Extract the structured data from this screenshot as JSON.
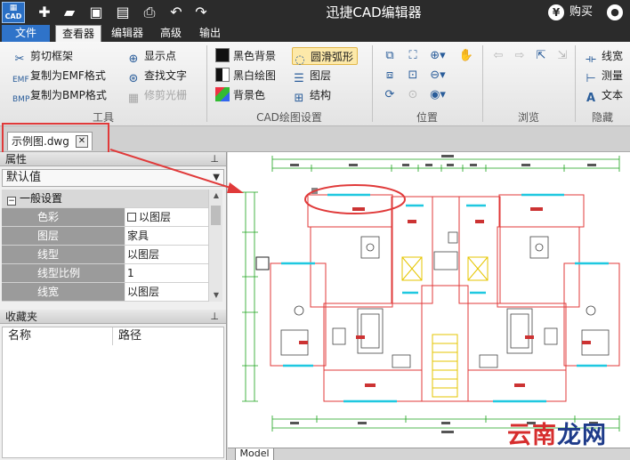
{
  "app": {
    "logo_text": "CAD",
    "title": "迅捷CAD编辑器",
    "buy_label": "购买",
    "currency_symbol": "¥"
  },
  "quick_access": [
    "new-icon",
    "open-icon",
    "save-icon",
    "save-as-icon",
    "print-icon",
    "undo-icon",
    "redo-icon"
  ],
  "menu": {
    "file": "文件",
    "viewer": "查看器",
    "editor": "编辑器",
    "advanced": "高级",
    "export": "输出"
  },
  "ribbon": {
    "tools": {
      "label": "工具",
      "clip_frame": "剪切框架",
      "copy_emf": "复制为EMF格式",
      "copy_bmp": "复制为BMP格式",
      "show_points": "显示点",
      "find_text": "查找文字",
      "trim_raster": "修剪光栅"
    },
    "cad_settings": {
      "label": "CAD绘图设置",
      "black_bg": "黑色背景",
      "bw_drawing": "黑白绘图",
      "bg_color": "背景色",
      "smooth_arc": "圆滑弧形",
      "layers": "图层",
      "structure": "结构"
    },
    "position": {
      "label": "位置"
    },
    "browse": {
      "label": "浏览"
    },
    "hide": {
      "label": "隐藏",
      "line_width": "线宽",
      "measure": "测量",
      "text": "文本"
    }
  },
  "doc_tab": {
    "name": "示例图.dwg"
  },
  "properties": {
    "title": "属性",
    "selector": "默认值",
    "category": "一般设置",
    "rows": [
      {
        "key": "色彩",
        "value": "以图层"
      },
      {
        "key": "图层",
        "value": "家具"
      },
      {
        "key": "线型",
        "value": "以图层"
      },
      {
        "key": "线型比例",
        "value": "1"
      },
      {
        "key": "线宽",
        "value": "以图层"
      }
    ]
  },
  "favorites": {
    "title": "收藏夹",
    "col_name": "名称",
    "col_path": "路径"
  },
  "model_tab": "Model",
  "watermark": {
    "red": "云南",
    "blue": "龙网"
  },
  "colors": {
    "titlebar": "#2b2b2b",
    "accent": "#2f73c9",
    "annotation": "#e03a3a",
    "cad_wall": "#e03a3a",
    "cad_dim": "#1aa31a",
    "cad_window": "#1fc8e0"
  }
}
